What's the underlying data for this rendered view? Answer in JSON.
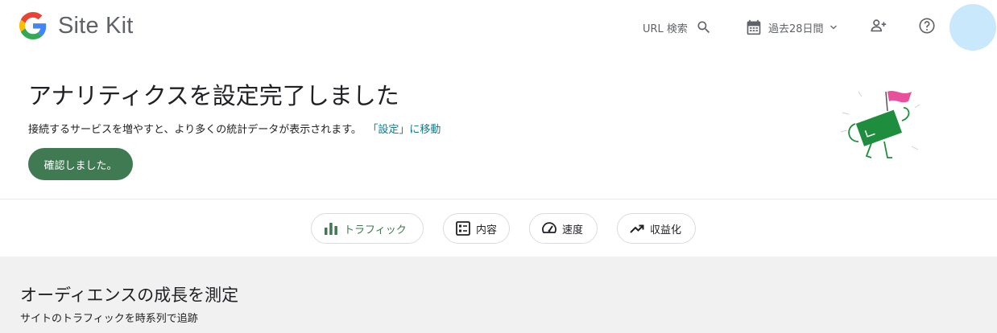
{
  "header": {
    "logo_text": "Site Kit",
    "search_label": "URL 検索",
    "date_range": "過去28日間",
    "icons": [
      "google-g-icon",
      "search-icon",
      "calendar-icon",
      "chevron-down-icon",
      "add-user-icon",
      "help-icon"
    ]
  },
  "banner": {
    "title": "アナリティクスを設定完了しました",
    "description": "接続するサービスを増やすと、より多くの統計データが表示されます。",
    "link": "「設定」に移動",
    "button": "確認しました。"
  },
  "tabs": [
    {
      "label": "トラフィック",
      "icon": "bar-chart-icon",
      "active": true
    },
    {
      "label": "内容",
      "icon": "content-list-icon",
      "active": false
    },
    {
      "label": "速度",
      "icon": "speedometer-icon",
      "active": false
    },
    {
      "label": "収益化",
      "icon": "trending-up-icon",
      "active": false
    }
  ],
  "section": {
    "title": "オーディエンスの成長を測定",
    "subtitle": "サイトのトラフィックを時系列で追跡"
  },
  "colors": {
    "accent_green": "#3f7a52",
    "link": "#137a8a",
    "avatar": "#c9e8fb",
    "section_bg": "#f1f1f1"
  }
}
